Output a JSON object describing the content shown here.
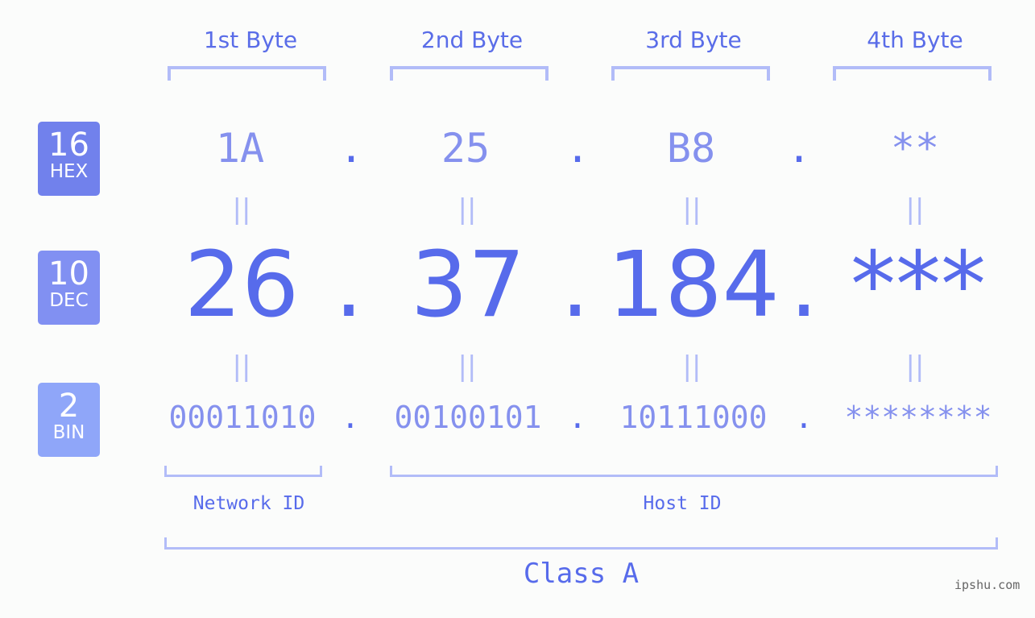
{
  "bytes": [
    {
      "title": "1st Byte",
      "hex": "1A",
      "dec": "26",
      "bin": "00011010"
    },
    {
      "title": "2nd Byte",
      "hex": "25",
      "dec": "37",
      "bin": "00100101"
    },
    {
      "title": "3rd Byte",
      "hex": "B8",
      "dec": "184",
      "bin": "10111000"
    },
    {
      "title": "4th Byte",
      "hex": "**",
      "dec": "***",
      "bin": "********"
    }
  ],
  "separator": ".",
  "equals": "||",
  "bases": [
    {
      "num": "16",
      "label": "HEX",
      "color": "#7181ec"
    },
    {
      "num": "10",
      "label": "DEC",
      "color": "#8190f2"
    },
    {
      "num": "2",
      "label": "BIN",
      "color": "#8fa6f9"
    }
  ],
  "sections": {
    "network": "Network ID",
    "host": "Host ID",
    "class": "Class A"
  },
  "watermark": "ipshu.com",
  "colors": {
    "accent": "#576beb",
    "light": "#8591ee",
    "bracket": "#b2bcf8"
  }
}
